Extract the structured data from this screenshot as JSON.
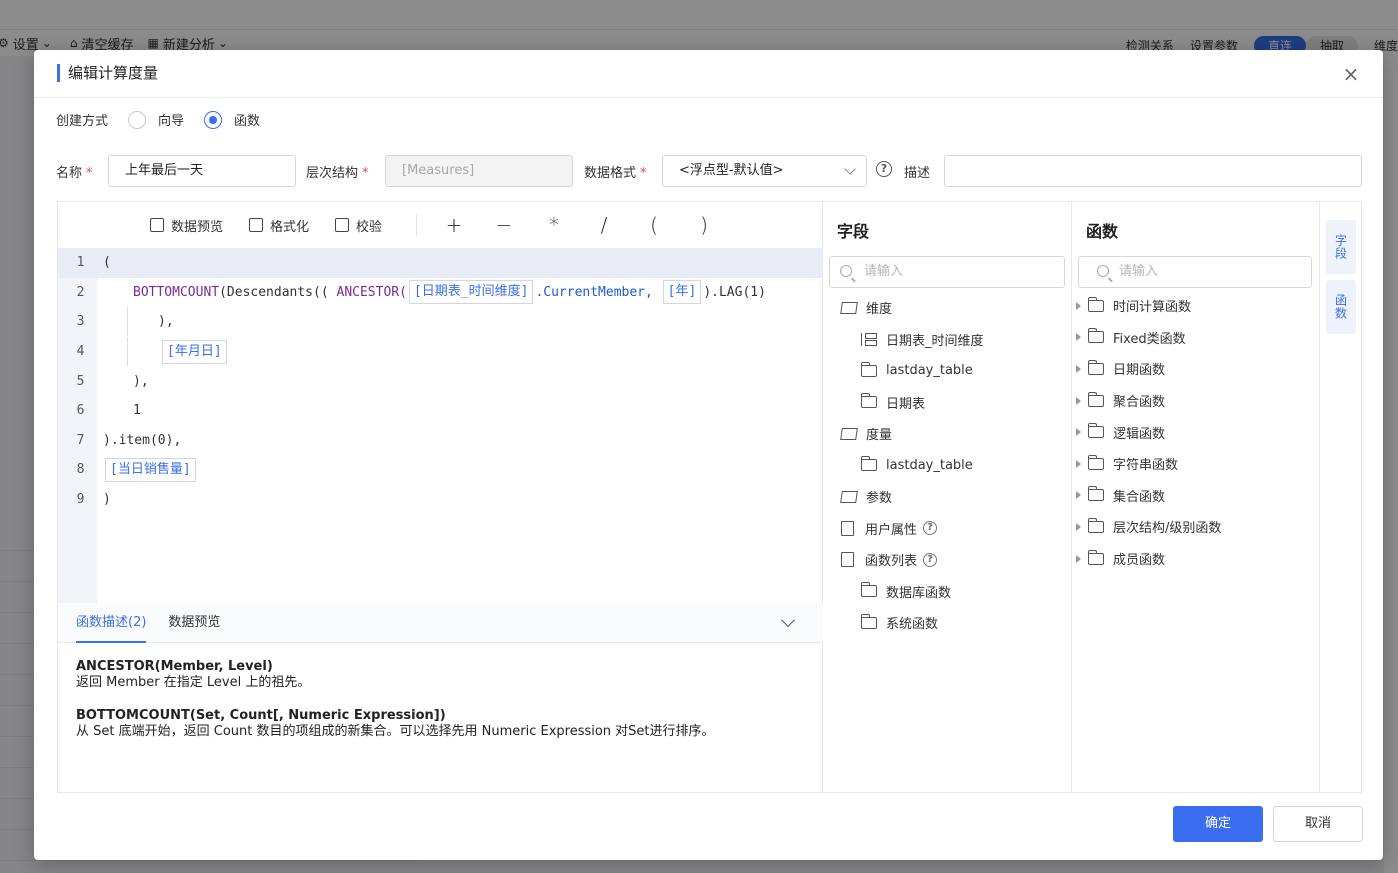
{
  "background": {
    "toolbar": {
      "settings": "设置",
      "clear_cache": "清空缓存",
      "new_analysis": "新建分析"
    },
    "right_tools": {
      "detect": "检测关系",
      "set_param": "设置参数",
      "direct": "直连",
      "extract": "抽取",
      "dimension": "维度"
    }
  },
  "modal": {
    "title": "编辑计算度量",
    "create_mode": {
      "label": "创建方式",
      "options": [
        "向导",
        "函数"
      ],
      "selected": "函数"
    },
    "fields": {
      "name_label": "名称",
      "name_value": "上年最后一天",
      "hierarchy_label": "层次结构",
      "hierarchy_value": "[Measures]",
      "format_label": "数据格式",
      "format_value": "<浮点型-默认值>",
      "desc_label": "描述",
      "desc_value": ""
    },
    "toolbar": {
      "preview": "数据预览",
      "format": "格式化",
      "validate": "校验",
      "ops": [
        "+",
        "−",
        "*",
        "/",
        "(",
        ")"
      ]
    },
    "code": {
      "line_numbers": [
        "1",
        "2",
        "3",
        "4",
        "5",
        "6",
        "7",
        "8",
        "9"
      ],
      "l1": "(",
      "l2_fn": "BOTTOMCOUNT",
      "l2_a": "(Descendants(( ",
      "l2_fn2": "ANCESTOR(",
      "l2_tok1": "[日期表_时间维度]",
      "l2_b": ".CurrentMember, ",
      "l2_tok2": "[年]",
      "l2_c": ").LAG(1)",
      "l3": "),",
      "l4_tok": "[年月日]",
      "l5": "),",
      "l6": "1",
      "l7": ").item(0),",
      "l8_tok": "[当日销售量]",
      "l9": ")"
    },
    "desc_tabs": [
      "函数描述(2)",
      "数据预览"
    ],
    "descriptions": [
      {
        "fn": "ANCESTOR(Member, Level)",
        "text": "返回 Member 在指定 Level 上的祖先。"
      },
      {
        "fn": "BOTTOMCOUNT(Set, Count[, Numeric Expression])",
        "text": "从 Set 底端开始，返回 Count 数目的项组成的新集合。可以选择先用 Numeric Expression 对Set进行排序。"
      }
    ],
    "fields_panel": {
      "title": "字段",
      "search_placeholder": "请输入",
      "items": [
        {
          "label": "维度"
        },
        {
          "label": "日期表_时间维度"
        },
        {
          "label": "lastday_table"
        },
        {
          "label": "日期表"
        },
        {
          "label": "度量"
        },
        {
          "label": "lastday_table"
        },
        {
          "label": "参数"
        },
        {
          "label": "用户属性"
        },
        {
          "label": "函数列表"
        },
        {
          "label": "数据库函数"
        },
        {
          "label": "系统函数"
        }
      ]
    },
    "func_panel": {
      "title": "函数",
      "search_placeholder": "请输入",
      "items": [
        "时间计算函数",
        "Fixed类函数",
        "日期函数",
        "聚合函数",
        "逻辑函数",
        "字符串函数",
        "集合函数",
        "层次结构/级别函数",
        "成员函数"
      ]
    },
    "side_tabs": [
      "字段",
      "函数"
    ],
    "ok": "确定",
    "cancel": "取消"
  },
  "colors": {
    "accent": "#3a6df0",
    "required": "#e5484d",
    "keyword": "#7b2a9a"
  }
}
